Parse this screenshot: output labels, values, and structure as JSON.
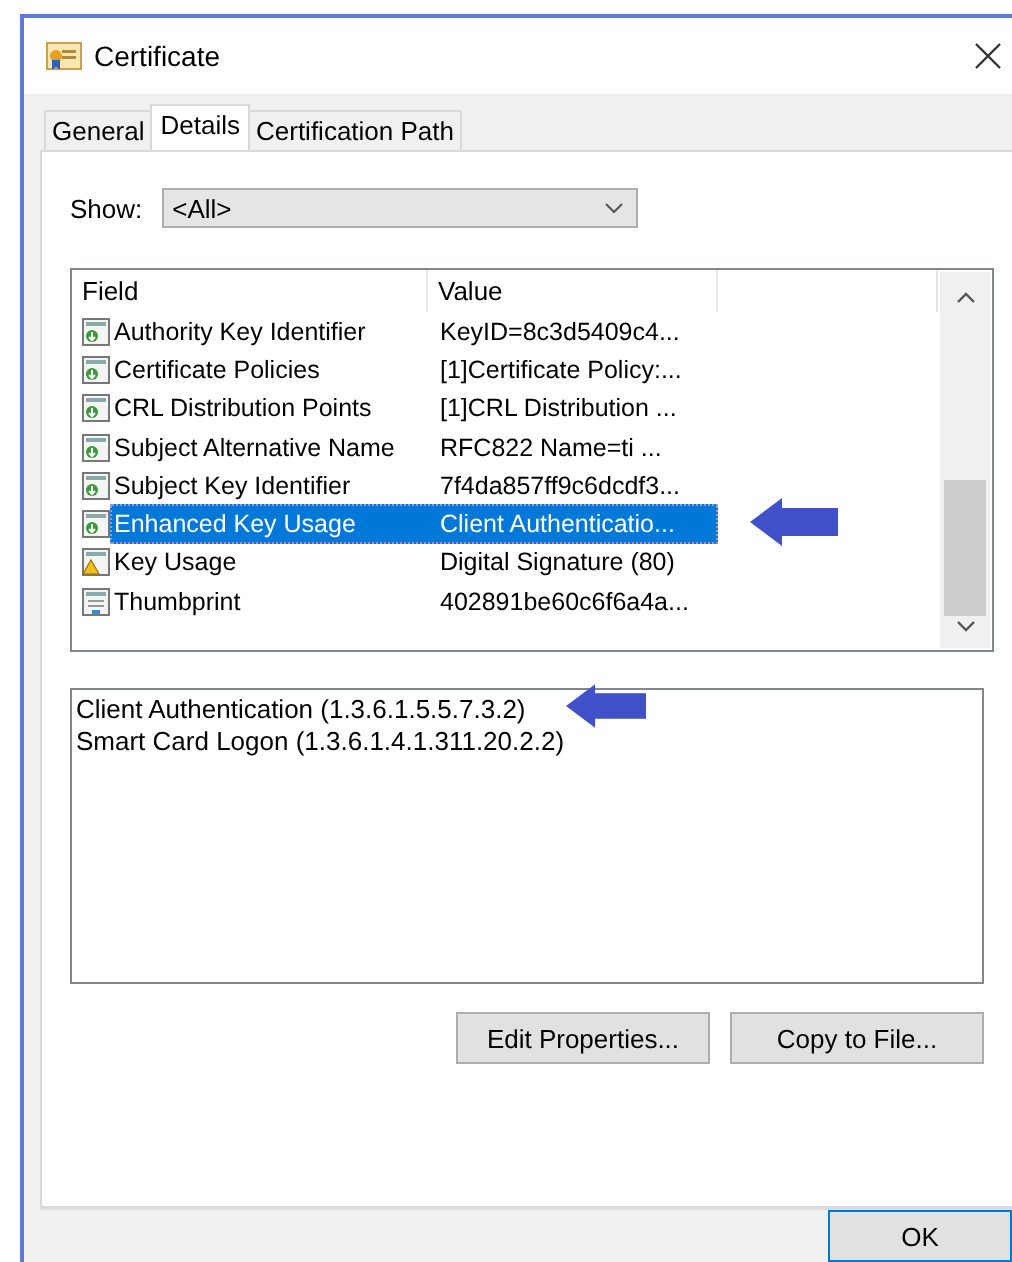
{
  "window": {
    "title": "Certificate"
  },
  "tabs": [
    {
      "label": "General",
      "selected": false
    },
    {
      "label": "Details",
      "selected": true
    },
    {
      "label": "Certification Path",
      "selected": false
    }
  ],
  "show": {
    "label": "Show:",
    "value": "<All>"
  },
  "fields_table": {
    "columns": [
      "Field",
      "Value"
    ],
    "rows": [
      {
        "kind": "extension",
        "field": "Authority Key Identifier",
        "value": "KeyID=8c3d5409c4...",
        "selected": false
      },
      {
        "kind": "extension",
        "field": "Certificate Policies",
        "value": "[1]Certificate Policy:...",
        "selected": false
      },
      {
        "kind": "extension",
        "field": "CRL Distribution Points",
        "value": "[1]CRL Distribution ...",
        "selected": false
      },
      {
        "kind": "extension",
        "field": "Subject Alternative Name",
        "value": "RFC822 Name=ti ...",
        "selected": false
      },
      {
        "kind": "extension",
        "field": "Subject Key Identifier",
        "value": "7f4da857ff9c6dcdf3...",
        "selected": false
      },
      {
        "kind": "extension",
        "field": "Enhanced Key Usage",
        "value": "Client Authenticatio...",
        "selected": true
      },
      {
        "kind": "critical",
        "field": "Key Usage",
        "value": "Digital Signature (80)",
        "selected": false
      },
      {
        "kind": "property",
        "field": "Thumbprint",
        "value": "402891be60c6f6a4a...",
        "selected": false
      }
    ]
  },
  "detail_lines": [
    "Client Authentication (1.3.6.1.5.5.7.3.2)",
    "Smart Card Logon (1.3.6.1.4.1.311.20.2.2)"
  ],
  "buttons": [
    "Edit Properties...",
    "Copy to File..."
  ],
  "footer_buttons": [
    "OK"
  ]
}
